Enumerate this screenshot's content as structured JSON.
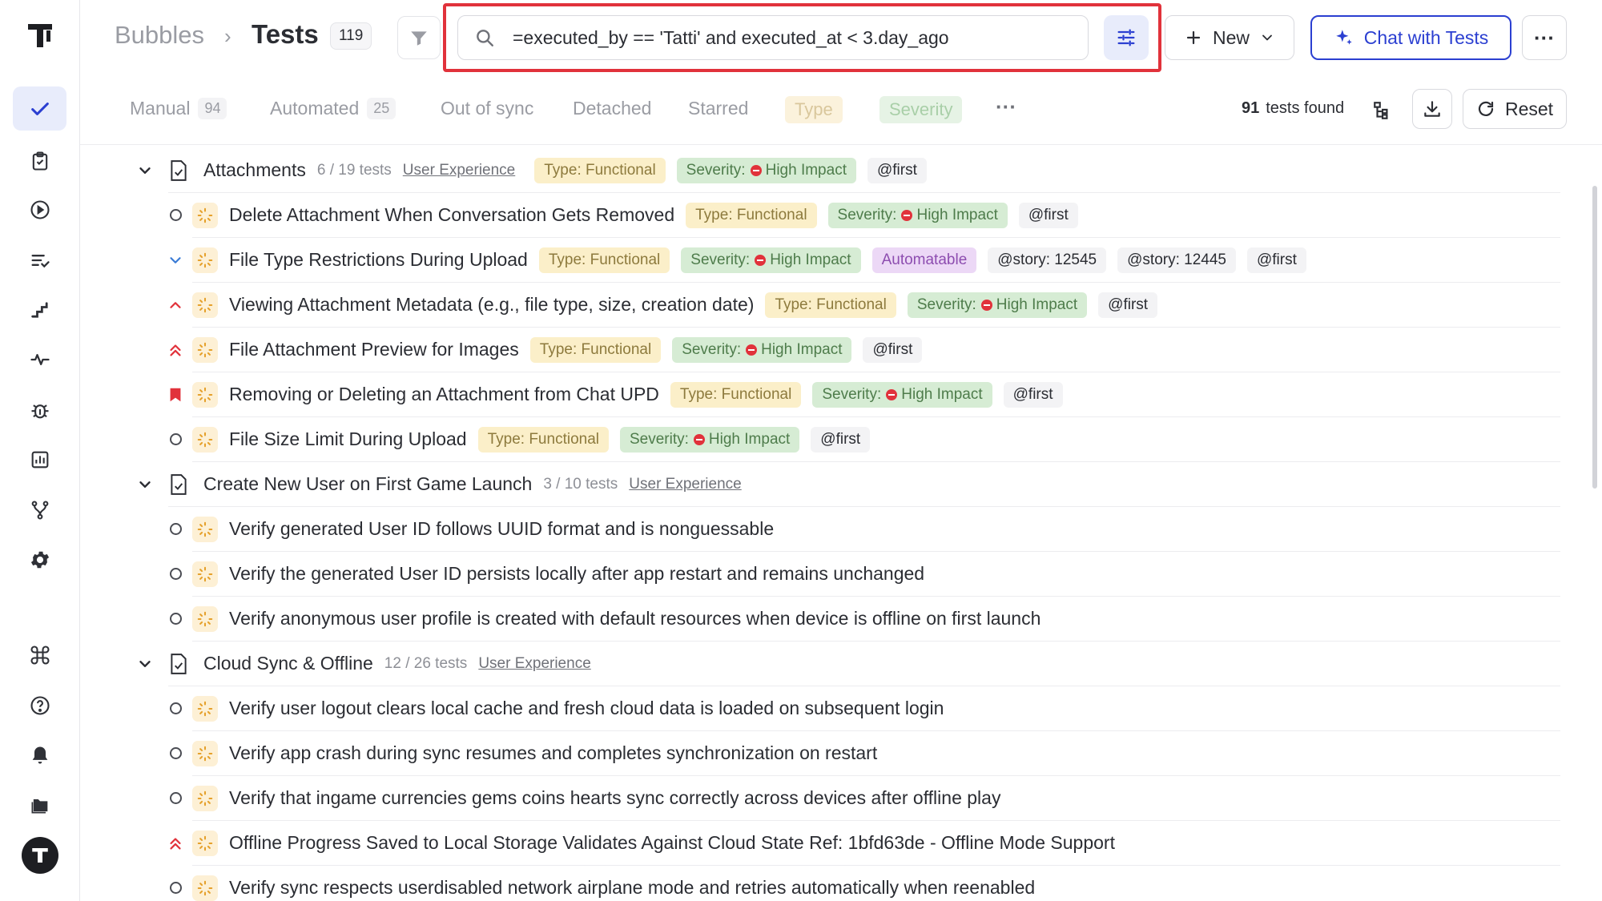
{
  "breadcrumb": {
    "project": "Bubbles",
    "separator": "›",
    "title": "Tests",
    "count": "119"
  },
  "search": {
    "value": "=executed_by == 'Tatti' and executed_at < 3.day_ago",
    "placeholder": ""
  },
  "header_buttons": {
    "new_label": "New",
    "chat_label": "Chat with Tests",
    "more_label": "···"
  },
  "tabs": [
    {
      "label": "Manual",
      "count": "94"
    },
    {
      "label": "Automated",
      "count": "25"
    },
    {
      "label": "Out of sync"
    },
    {
      "label": "Detached"
    },
    {
      "label": "Starred"
    }
  ],
  "tab_chips": {
    "type": "Type",
    "severity": "Severity",
    "more": "···"
  },
  "results": {
    "count": "91",
    "label": "tests found"
  },
  "reset_label": "Reset",
  "colors": {
    "accent": "#2b3fd1",
    "highlight": "#e1323b",
    "type_tag": "#fbefc9",
    "severity_tag": "#d6ecd4",
    "automatable_tag": "#ecd8f6"
  },
  "suites": [
    {
      "title": "Attachments",
      "count": "6 / 19 tests",
      "link": "User Experience",
      "type": "Type: Functional",
      "sev_prefix": "Severity:",
      "sev_value": "High Impact",
      "label": "@first",
      "tests": [
        {
          "title": "Delete Attachment When Conversation Gets Removed",
          "priority": "normal",
          "type": "Type: Functional",
          "sev_prefix": "Severity:",
          "sev_value": "High Impact",
          "labels": [
            "@first"
          ]
        },
        {
          "title": "File Type Restrictions During Upload",
          "priority": "low",
          "type": "Type: Functional",
          "sev_prefix": "Severity:",
          "sev_value": "High Impact",
          "auto": "Automatable",
          "labels": [
            "@story: 12545",
            "@story: 12445",
            "@first"
          ]
        },
        {
          "title": "Viewing Attachment Metadata (e.g., file type, size, creation date)",
          "priority": "high",
          "type": "Type: Functional",
          "sev_prefix": "Severity:",
          "sev_value": "High Impact",
          "labels": [
            "@first"
          ]
        },
        {
          "title": "File Attachment Preview for Images",
          "priority": "urgent",
          "type": "Type: Functional",
          "sev_prefix": "Severity:",
          "sev_value": "High Impact",
          "labels": [
            "@first"
          ]
        },
        {
          "title": "Removing or Deleting an Attachment from Chat UPD",
          "priority": "critical",
          "type": "Type: Functional",
          "sev_prefix": "Severity:",
          "sev_value": "High Impact",
          "labels": [
            "@first"
          ]
        },
        {
          "title": "File Size Limit During Upload",
          "priority": "normal",
          "type": "Type: Functional",
          "sev_prefix": "Severity:",
          "sev_value": "High Impact",
          "labels": [
            "@first"
          ]
        }
      ]
    },
    {
      "title": "Create New User on First Game Launch",
      "count": "3 / 10 tests",
      "link": "User Experience",
      "tests": [
        {
          "title": "Verify generated User ID follows UUID format and is nonguessable",
          "priority": "normal"
        },
        {
          "title": "Verify the generated User ID persists locally after app restart and remains unchanged",
          "priority": "normal"
        },
        {
          "title": "Verify anonymous user profile is created with default resources when device is offline on first launch",
          "priority": "normal"
        }
      ]
    },
    {
      "title": "Cloud Sync & Offline",
      "count": "12 / 26 tests",
      "link": "User Experience",
      "tests": [
        {
          "title": "Verify user logout clears local cache and fresh cloud data is loaded on subsequent login",
          "priority": "normal"
        },
        {
          "title": "Verify app crash during sync resumes and completes synchronization on restart",
          "priority": "normal"
        },
        {
          "title": "Verify that ingame currencies gems coins hearts sync correctly across devices after offline play",
          "priority": "normal"
        },
        {
          "title": "Offline Progress Saved to Local Storage Validates Against Cloud State Ref: 1bfd63de - Offline Mode Support",
          "priority": "urgent"
        },
        {
          "title": "Verify sync respects userdisabled network airplane mode and retries automatically when reenabled",
          "priority": "normal"
        }
      ]
    }
  ]
}
